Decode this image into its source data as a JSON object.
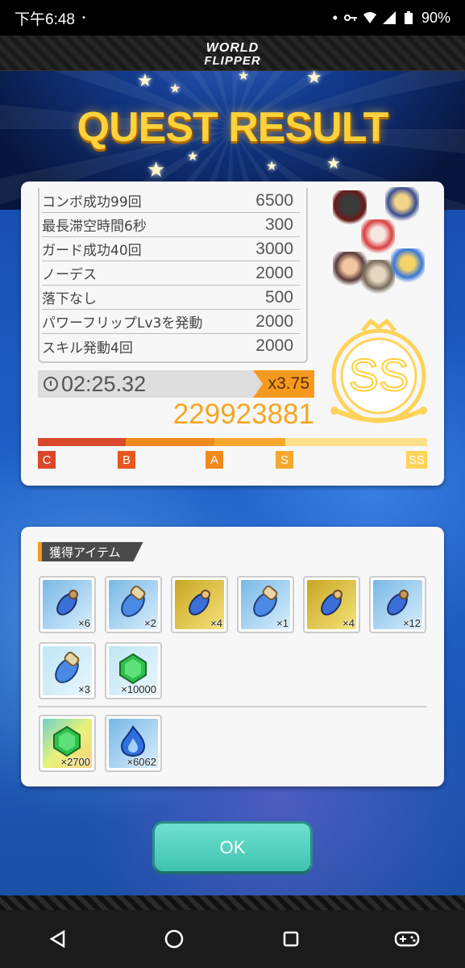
{
  "status_bar": {
    "time": "下午6:48",
    "dot": "•",
    "battery": "90%"
  },
  "app": {
    "logo_line1": "WORLD",
    "logo_line2": "FLIPPER"
  },
  "title": "QUEST RESULT",
  "result": {
    "bonuses": [
      {
        "name": "コンボ成功99回",
        "points": "6500"
      },
      {
        "name": "最長滞空時間6秒",
        "points": "300"
      },
      {
        "name": "ガード成功40回",
        "points": "3000"
      },
      {
        "name": "ノーデス",
        "points": "2000"
      },
      {
        "name": "落下なし",
        "points": "500"
      },
      {
        "name": "パワーフリップLv3を発動",
        "points": "2000"
      },
      {
        "name": "スキル発動4回",
        "points": "2000"
      }
    ],
    "clear_time": "02:25.32",
    "multiplier": "x3.75",
    "score": "229923881",
    "rank": "SS",
    "gauge": {
      "marks": [
        "C",
        "B",
        "A",
        "S",
        "SS"
      ],
      "colors": {
        "C": "#d9482b",
        "B": "#e8571f",
        "A": "#f08a1c",
        "S": "#f6a82d",
        "SS": "#ffd35a"
      }
    }
  },
  "items": {
    "header": "獲得アイテム",
    "row1": [
      {
        "icon": "small-bomb-icon",
        "bg": "blue",
        "count": "×6"
      },
      {
        "icon": "scroll-capsule-icon",
        "bg": "blue",
        "count": "×2"
      },
      {
        "icon": "gold-bomb-icon",
        "bg": "gold",
        "count": "×4"
      },
      {
        "icon": "scroll-capsule-icon",
        "bg": "blue",
        "count": "×1"
      },
      {
        "icon": "gold-bomb-icon",
        "bg": "gold",
        "count": "×4"
      },
      {
        "icon": "small-bomb-icon",
        "bg": "blue",
        "count": "×12"
      }
    ],
    "row2": [
      {
        "icon": "scroll-capsule-icon",
        "bg": "green",
        "count": "×3"
      },
      {
        "icon": "green-gem-icon",
        "bg": "green",
        "count": "×10000"
      }
    ],
    "row3": [
      {
        "icon": "green-gem-icon",
        "bg": "rainbow",
        "count": "×2700"
      },
      {
        "icon": "blue-flame-icon",
        "bg": "blue",
        "count": "×6062"
      }
    ]
  },
  "ok_label": "OK"
}
